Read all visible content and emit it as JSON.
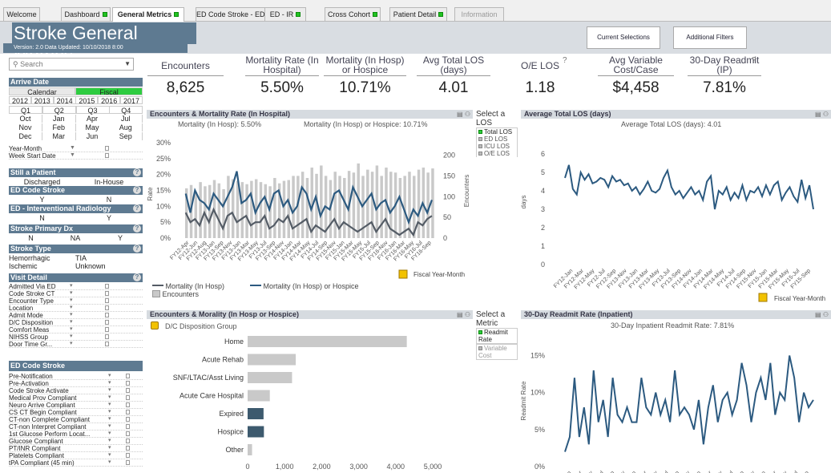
{
  "tabs": [
    {
      "label": "Welcome",
      "ind": false
    },
    {
      "label": "Dashboard",
      "ind": true
    },
    {
      "label": "General Metrics",
      "ind": true
    },
    {
      "label": "ED Code Stroke - ED",
      "ind": true
    },
    {
      "label": "ED - IR",
      "ind": true
    },
    {
      "label": "Cross Cohort",
      "ind": true
    },
    {
      "label": "Patient Detail",
      "ind": true
    },
    {
      "label": "Information",
      "ind": false
    }
  ],
  "header": {
    "title": "Stroke General Metrics",
    "version": "Version: 2.0      Data Updated:  10/10/2018 8:00",
    "current_selections": "Current Selections",
    "additional_filters": "Additional Filters"
  },
  "kpis": [
    {
      "label": "Encounters",
      "value": "8,625"
    },
    {
      "label": "Mortality Rate (In Hospital)",
      "value": "5.50%"
    },
    {
      "label": "Mortality (In Hosp) or Hospice",
      "value": "10.71%"
    },
    {
      "label": "Avg Total LOS (days)",
      "value": "4.01"
    },
    {
      "label": "O/E LOS",
      "value": "1.18"
    },
    {
      "label": "Avg Variable Cost/Case",
      "value": "$4,458"
    },
    {
      "label": "30-Day Readmit (IP)",
      "value": "7.81%"
    }
  ],
  "search": {
    "placeholder": "Search"
  },
  "arrive_date": {
    "title": "Arrive Date",
    "calendar": "Calendar",
    "fiscal": "Fiscal",
    "years": [
      "2012",
      "2013",
      "2014",
      "2015",
      "2016",
      "2017"
    ],
    "quarters": [
      "Q1",
      "Q2",
      "Q3",
      "Q4"
    ],
    "months": [
      [
        "Oct",
        "Nov",
        "Dec"
      ],
      [
        "Jan",
        "Feb",
        "Mar"
      ],
      [
        "Apr",
        "May",
        "Jun"
      ],
      [
        "Jul",
        "Aug",
        "Sep"
      ]
    ],
    "year_month": "Year-Month",
    "week_start": "Week Start Date"
  },
  "still_patient": {
    "title": "Still a Patient",
    "a": "Discharged",
    "b": "In-House"
  },
  "ed_code": {
    "title": "ED Code Stroke",
    "a": "Y",
    "b": "N"
  },
  "ed_ir": {
    "title": "ED - Interventional Radiology",
    "a": "N",
    "b": "Y"
  },
  "primary_dx": {
    "title": "Stroke Primary Dx",
    "a": "N",
    "b": "NA",
    "c": "Y"
  },
  "stroke_type": {
    "title": "Stroke Type",
    "items": [
      "Hemorrhagic",
      "TIA",
      "Ischemic",
      "Unknown"
    ]
  },
  "visit_detail": {
    "title": "Visit Detail",
    "items": [
      "Admitted Via ED",
      "Code Stroke CT",
      "Encounter Type",
      "Location",
      "Admit Mode",
      "D/C Disposition",
      "Comfort Meas",
      "NIHSS Group",
      "Door Time Gr..."
    ]
  },
  "ed_code_stroke": {
    "title": "ED Code Stroke",
    "items": [
      "Pre-Notification",
      "Pre-Activation",
      "Code Stroke Activate",
      "Medical Prov Compliant",
      "Neuro Arrive Compliant",
      "CS CT Begin Compliant",
      "CT-non Complete Compliant",
      "CT-non Interpret Compliant",
      "1st Glucose Perform Locat...",
      "Glucose Compliant",
      "PT/INR Compliant",
      "Platelets Compliant",
      "tPA Compliant (45 min)"
    ]
  },
  "chart1": {
    "title": "Encounters & Mortality Rate (In Hospital)",
    "sub1": "Mortality (In Hosp): 5.50%",
    "sub2": "Mortality (In Hosp) or Hospice: 10.71%",
    "xlabel": "Fiscal Year-Month",
    "ylabel": "Rate",
    "y2label": "Encounters",
    "legend": [
      "Mortality (In Hosp)",
      "Mortality (In Hosp) or Hospice",
      "Encounters"
    ]
  },
  "los_selector": {
    "title": "Select a LOS",
    "options": [
      "Total LOS",
      "ED LOS",
      "ICU LOS",
      "O/E LOS"
    ]
  },
  "chart2": {
    "title": "Average Total LOS (days)",
    "sub": "Average Total LOS (days):  4.01",
    "xlabel": "Fiscal Year-Month",
    "ylabel": "days"
  },
  "chart3": {
    "title": "Encounters & Morality (In Hosp or Hospice)",
    "group": "D/C Disposition Group"
  },
  "metric_selector": {
    "title": "Select a Metric",
    "options": [
      "Readmit Rate",
      "Variable Cost"
    ]
  },
  "chart4": {
    "title": "30-Day Readmit Rate (Inpatient)",
    "sub": "30-Day Inpatient Readmit Rate:  7.81%",
    "ylabel": "Readmit Rate"
  },
  "colors": {
    "header": "#5e7a91",
    "dark_line": "#2c5a80",
    "gray_line": "#545c66",
    "bar_gray": "#c9c9c9",
    "bar_dark": "#3d5a6e",
    "green": "#2ecc40"
  },
  "chart_data": [
    {
      "type": "bar",
      "title": "Encounters & Mortality Rate (In Hospital)",
      "categories": [
        "FY12-Apr",
        "FY12-May",
        "FY12-Jun",
        "FY12-Jul",
        "FY12-Aug",
        "FY12-Sep",
        "FY13-Oct",
        "FY13-Nov",
        "FY13-Dec",
        "FY13-Jan",
        "FY13-Feb",
        "FY13-Mar",
        "FY13-Apr",
        "FY13-May",
        "FY13-Jun",
        "FY13-Jul",
        "FY13-Aug",
        "FY13-Sep",
        "FY14-Oct",
        "FY14-Nov",
        "FY14-Dec",
        "FY14-Jan",
        "FY14-Feb",
        "FY14-Mar",
        "FY14-Apr",
        "FY14-May",
        "FY14-Jun",
        "FY14-Jul",
        "FY14-Aug",
        "FY14-Sep",
        "FY15-Oct",
        "FY15-Nov",
        "FY15-Dec",
        "FY15-Jan",
        "FY15-Feb",
        "FY15-Mar",
        "FY15-Apr",
        "FY15-May",
        "FY15-Jun",
        "FY15-Jul",
        "FY15-Aug",
        "FY15-Sep",
        "FY16-Oct",
        "FY16-Nov",
        "FY16-Dec",
        "FY16-Jan",
        "FY16-Feb",
        "FY16-Mar",
        "FY16-Apr",
        "FY16-May",
        "FY16-Jun",
        "FY16-Jul",
        "FY16-Aug",
        "FY16-Sep"
      ],
      "tick_labels": [
        "FY12-Apr",
        "FY12-Jun",
        "FY12-Aug",
        "FY13-Jan",
        "FY13-Sep",
        "FY13-Nov",
        "FY13-Jan",
        "FY13-Mar",
        "FY13-May",
        "FY13-Jul",
        "FY13-Sep",
        "FY14-Nov",
        "FY14-Jan",
        "FY14-Mar",
        "FY14-May",
        "FY14-Jul",
        "FY14-Sep",
        "FY15-Nov",
        "FY15-Jan",
        "FY15-Mar",
        "FY15-May",
        "FY15-Jul",
        "FY15-Sep",
        "FY16-Nov",
        "FY16-Jan",
        "FY16-Mar",
        "FY16-May",
        "FY16-Jul",
        "FY16-Sep"
      ],
      "yticks": [
        "0%",
        "5%",
        "10%",
        "15%",
        "20%",
        "25%",
        "30%"
      ],
      "y2ticks": [
        "0",
        "50",
        "100",
        "150",
        "200"
      ],
      "ylim": [
        0,
        30
      ],
      "y2lim": [
        0,
        230
      ],
      "series": [
        {
          "name": "Encounters",
          "values": [
            120,
            128,
            112,
            135,
            125,
            128,
            140,
            132,
            118,
            150,
            142,
            138,
            135,
            130,
            138,
            142,
            135,
            130,
            125,
            145,
            132,
            138,
            140,
            150,
            150,
            160,
            145,
            170,
            155,
            175,
            150,
            140,
            160,
            150,
            145,
            162,
            158,
            180,
            150,
            165,
            160,
            175,
            150,
            170,
            160,
            158,
            145,
            150,
            160,
            150,
            165,
            170,
            158,
            168
          ]
        },
        {
          "name": "Mortality (In Hosp)",
          "values": [
            8,
            5,
            6,
            4,
            8,
            5,
            9,
            6,
            3,
            7,
            8,
            5,
            6,
            7,
            4,
            5,
            5,
            7,
            3,
            4,
            6,
            5,
            7,
            3,
            4,
            5,
            6,
            2,
            4,
            3,
            2,
            4,
            6,
            3,
            5,
            4,
            3,
            2,
            3,
            4,
            5,
            2,
            4,
            6,
            3,
            2,
            1,
            2,
            3,
            1,
            5,
            4,
            6,
            7
          ]
        },
        {
          "name": "Mortality (In Hosp) or Hospice",
          "values": [
            14,
            8,
            15,
            12,
            11,
            9,
            14,
            12,
            10,
            13,
            16,
            21,
            11,
            12,
            14,
            8,
            11,
            13,
            9,
            14,
            15,
            10,
            12,
            8,
            10,
            16,
            14,
            9,
            13,
            7,
            10,
            9,
            14,
            15,
            12,
            9,
            16,
            13,
            10,
            12,
            14,
            9,
            11,
            12,
            8,
            10,
            13,
            9,
            5,
            9,
            7,
            11,
            8,
            12
          ]
        }
      ]
    },
    {
      "type": "line",
      "title": "Average Total LOS (days)",
      "yticks": [
        "0",
        "1",
        "2",
        "3",
        "4",
        "5",
        "6"
      ],
      "ylim": [
        0,
        6
      ],
      "tick_labels": [
        "FY12-Jan",
        "FY12-Mar",
        "FY12-May",
        "FY12-Jul",
        "FY12-Sep",
        "FY13-Nov",
        "FY13-Jan",
        "FY13-Mar",
        "FY13-May",
        "FY13-Jul",
        "FY13-Sep",
        "FY14-Nov",
        "FY14-Jan",
        "FY14-Mar",
        "FY14-May",
        "FY14-Jul",
        "FY14-Sep",
        "FY15-Nov",
        "FY15-Jan",
        "FY15-Mar",
        "FY15-May",
        "FY15-Jul",
        "FY15-Sep"
      ],
      "series": [
        {
          "name": "Average Total LOS (days)",
          "values": [
            4.7,
            5.4,
            4.1,
            3.8,
            5.0,
            4.6,
            4.9,
            4.4,
            4.5,
            4.7,
            4.6,
            4.2,
            4.8,
            4.5,
            4.6,
            4.3,
            4.4,
            4.0,
            4.2,
            3.8,
            4.1,
            4.5,
            4.0,
            3.9,
            4.1,
            4.7,
            5.1,
            4.2,
            3.8,
            4.0,
            3.6,
            3.9,
            4.2,
            3.8,
            4.0,
            3.5,
            4.5,
            4.8,
            3.0,
            4.0,
            3.8,
            4.2,
            3.5,
            3.9,
            3.6,
            4.3,
            3.5,
            4.0,
            3.9,
            4.2,
            3.7,
            4.3,
            3.8,
            4.3,
            4.5,
            3.5,
            3.9,
            4.2,
            3.7,
            3.4,
            4.6,
            3.6,
            4.3,
            3.0
          ]
        }
      ]
    },
    {
      "type": "bar",
      "title": "Encounters & Morality (In Hosp or Hospice)",
      "categories": [
        "Home",
        "Acute Rehab",
        "SNF/LTAC/Asst Living",
        "Acute Care Hospital",
        "Expired",
        "Hospice",
        "Other"
      ],
      "values": [
        4300,
        1300,
        1200,
        600,
        430,
        440,
        120
      ],
      "xticks": [
        "0",
        "1,000",
        "2,000",
        "3,000",
        "4,000",
        "5,000"
      ],
      "xlim": [
        0,
        5000
      ]
    },
    {
      "type": "line",
      "title": "30-Day Readmit Rate (Inpatient)",
      "yticks": [
        "0%",
        "5%",
        "10%",
        "15%"
      ],
      "ylim": [
        0,
        17
      ],
      "tick_labels": [
        "Jan",
        "Mar",
        "May",
        "Jul",
        "Sep",
        "Nov",
        "Jan",
        "Mar",
        "May",
        "Jul",
        "Sep",
        "Nov",
        "Jan",
        "Mar",
        "May",
        "Jul",
        "Sep",
        "Nov",
        "Jan",
        "Mar",
        "May",
        "Jul",
        "Sep"
      ],
      "series": [
        {
          "name": "30-Day Readmit Rate",
          "values": [
            2,
            4,
            12,
            4,
            8,
            3,
            13,
            6,
            9,
            4,
            12,
            7,
            6,
            8,
            6,
            6,
            12,
            8,
            7,
            10,
            7,
            9,
            6,
            13,
            7,
            8,
            7,
            5,
            9,
            3,
            8,
            11,
            6,
            9,
            10,
            7,
            9,
            14,
            11,
            6,
            10,
            12,
            9,
            14,
            7,
            10,
            9,
            15,
            12,
            6,
            10,
            8,
            9
          ]
        }
      ]
    }
  ]
}
